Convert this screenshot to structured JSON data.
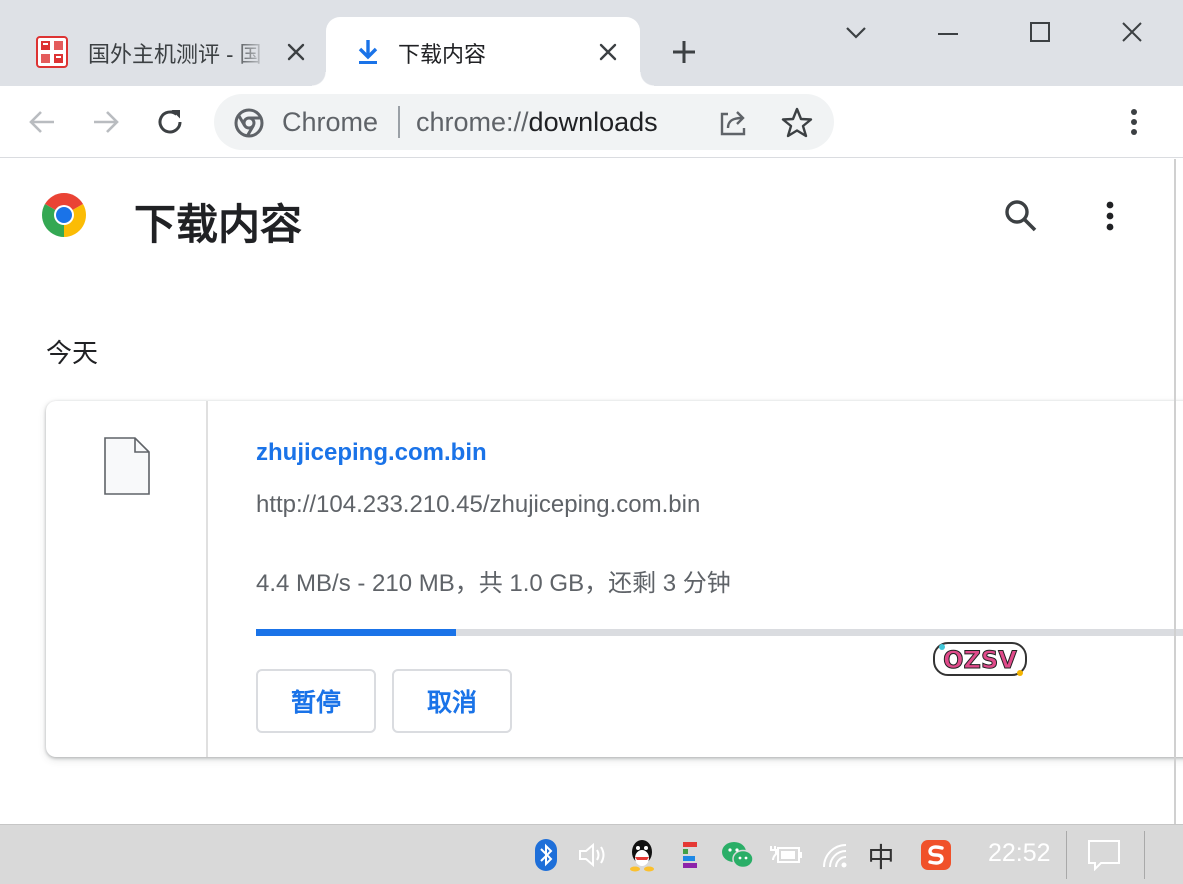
{
  "tabs": [
    {
      "title": "国外主机测评 - 国",
      "close_icon": "close-icon",
      "favicon": "site-seal-icon"
    },
    {
      "title": "下载内容",
      "close_icon": "close-icon",
      "favicon": "download-icon"
    }
  ],
  "toolbar": {
    "chip_label": "Chrome",
    "url_scheme": "chrome://",
    "url_path": "downloads"
  },
  "page": {
    "title": "下载内容",
    "date_group": "今天",
    "watermark": "zhujiceping.com"
  },
  "download": {
    "file_name": "zhujiceping.com.bin",
    "url": "http://104.233.210.45/zhujiceping.com.bin",
    "status": "4.4 MB/s - 210 MB，共 1.0 GB，还剩 3 分钟",
    "progress_percent": 21,
    "pause_label": "暂停",
    "cancel_label": "取消",
    "badge_text": "OZSV"
  },
  "taskbar": {
    "ime_label": "中",
    "clock": "22:52"
  },
  "colors": {
    "accent": "#1a73e8",
    "tabstrip": "#dee1e6",
    "taskbar": "#d9d9d9"
  }
}
